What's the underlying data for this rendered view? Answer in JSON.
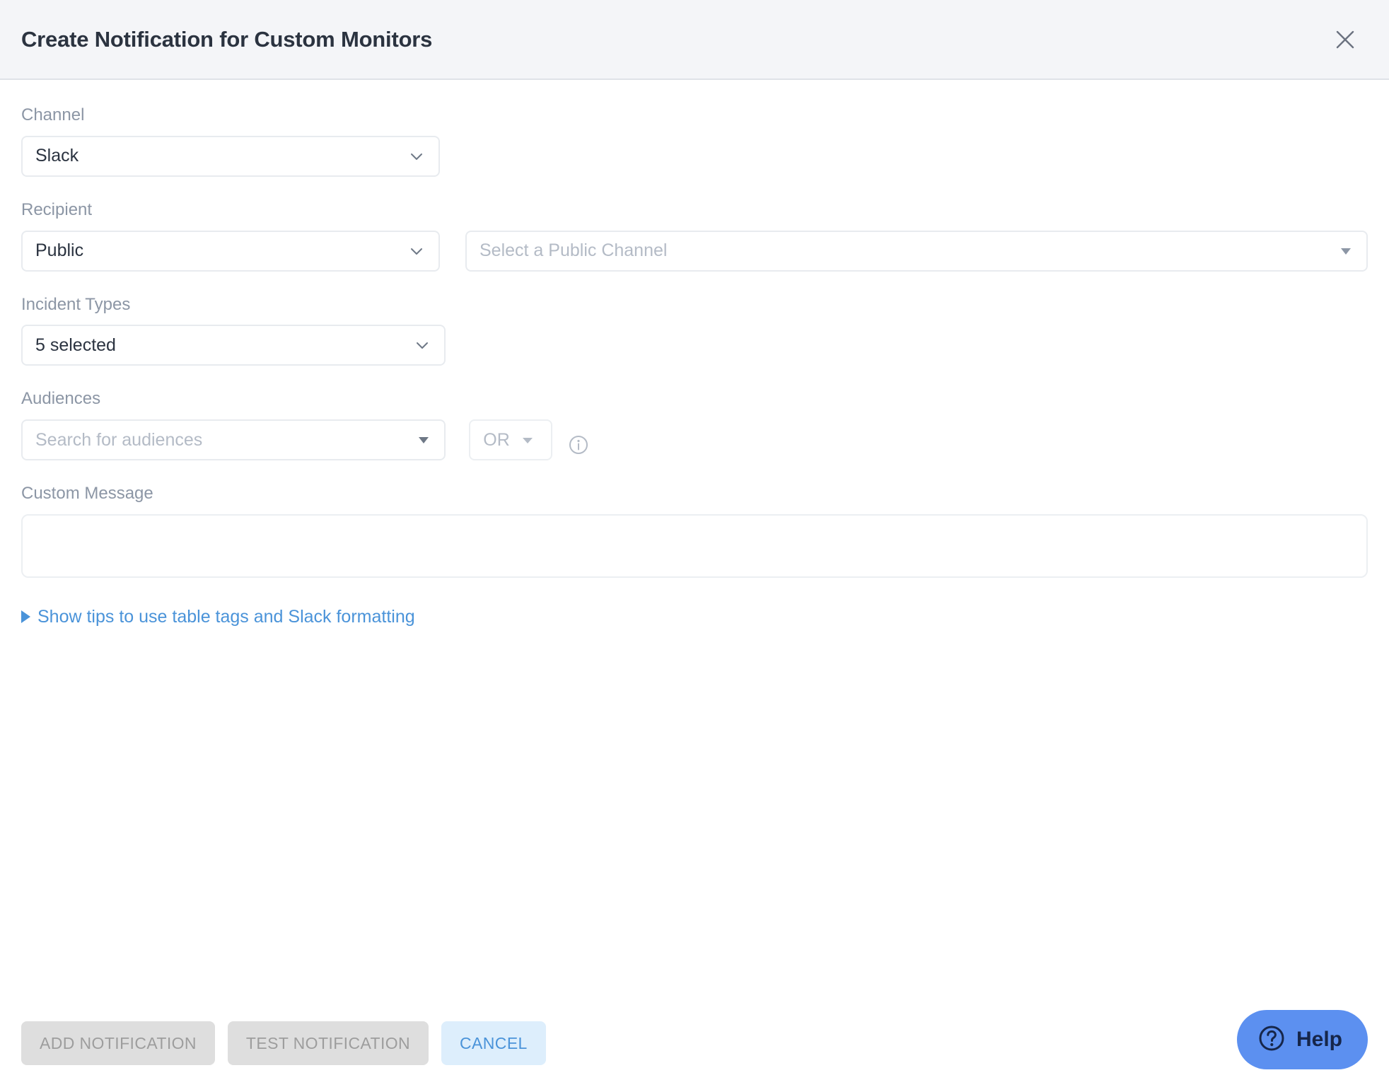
{
  "header": {
    "title": "Create Notification for Custom Monitors",
    "close_icon": "close-icon"
  },
  "form": {
    "channel": {
      "label": "Channel",
      "value": "Slack",
      "chevron_icon": "chevron-down-icon"
    },
    "recipient": {
      "label": "Recipient",
      "value": "Public",
      "chevron_icon": "chevron-down-icon",
      "channel_picker_placeholder": "Select a Public Channel",
      "channel_picker_icon": "triangle-down-icon"
    },
    "incident_types": {
      "label": "Incident Types",
      "value": "5 selected",
      "chevron_icon": "chevron-down-icon"
    },
    "audiences": {
      "label": "Audiences",
      "placeholder": "Search for audiences",
      "dropdown_icon": "triangle-down-icon",
      "operator": "OR",
      "operator_icon": "triangle-down-icon",
      "info_icon": "info-circle-icon"
    },
    "custom_message": {
      "label": "Custom Message",
      "value": "",
      "placeholder": ""
    },
    "tips": {
      "caret_icon": "triangle-right-icon",
      "label": "Show tips to use table tags and Slack formatting"
    }
  },
  "footer": {
    "add_notification_label": "ADD NOTIFICATION",
    "test_notification_label": "TEST NOTIFICATION",
    "cancel_label": "CANCEL"
  },
  "help_widget": {
    "icon": "question-circle-icon",
    "label": "Help"
  },
  "colors": {
    "header_bg": "#f4f5f8",
    "title_text": "#2b3340",
    "label_text": "#8c96a5",
    "border": "#e8ebef",
    "link_blue": "#4a93d9",
    "cancel_bg": "#ddeefc",
    "disabled_bg": "#dedede",
    "disabled_text": "#9d9d9d",
    "help_blue": "#5c90f0",
    "help_text": "#16264a"
  }
}
